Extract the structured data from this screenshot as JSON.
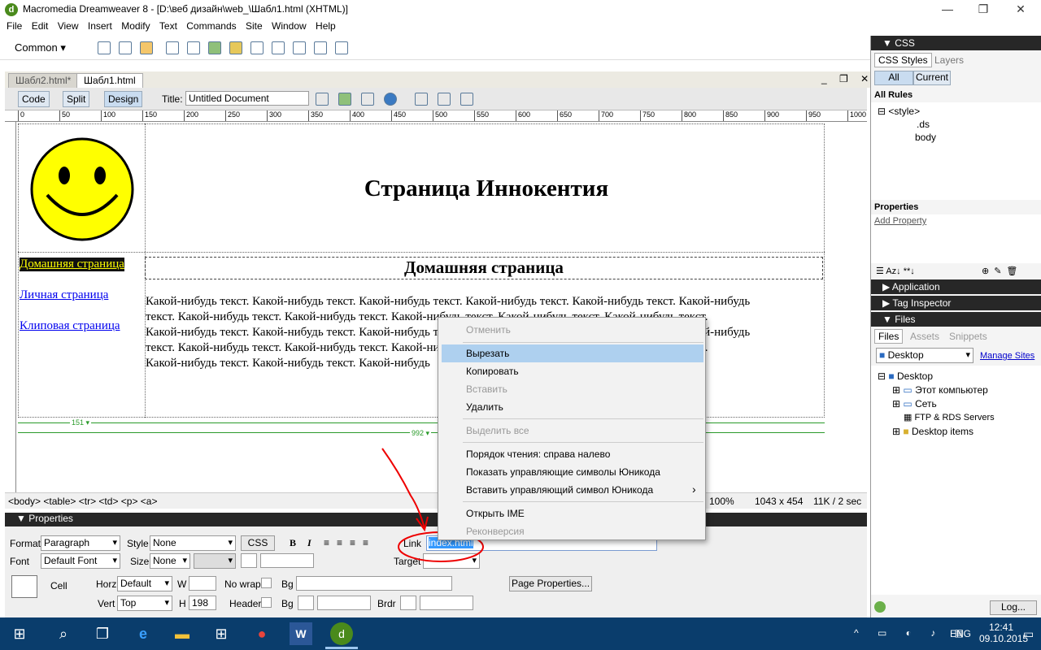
{
  "window": {
    "title": "Macromedia Dreamweaver 8 - [D:\\веб дизайн\\web_\\Шабл1.html (XHTML)]",
    "minimize": "—",
    "restore": "❐",
    "close": "✕"
  },
  "menu": [
    "File",
    "Edit",
    "View",
    "Insert",
    "Modify",
    "Text",
    "Commands",
    "Site",
    "Window",
    "Help"
  ],
  "insertbar": {
    "category": "Common"
  },
  "doc": {
    "tabs": [
      "Шабл2.html*",
      "Шабл1.html"
    ],
    "active_tab": 1,
    "view_buttons": [
      "Code",
      "Split",
      "Design"
    ],
    "title_label": "Title:",
    "title_value": "Untitled Document"
  },
  "ruler": {
    "h_ticks": [
      "0",
      "50",
      "100",
      "150",
      "200",
      "250",
      "300",
      "350",
      "400",
      "450",
      "500",
      "550",
      "600",
      "650",
      "700",
      "750",
      "800",
      "850",
      "900",
      "950",
      "1000"
    ]
  },
  "page": {
    "heading": "Страница Иннокентия",
    "nav": [
      "Домашняя страница",
      "Личная страница",
      "Клиповая страница"
    ],
    "subheading": "Домашняя страница",
    "body_lines": [
      "Какой-нибудь текст. Какой-нибудь текст. Какой-нибудь текст. Какой-нибудь текст. Какой-нибудь текст. Какой-нибудь",
      "текст. Какой-нибудь текст. Какой-нибудь текст. Какой-нибудь текст. Какой-нибудь текст. Какой-нибудь текст.",
      "Какой-нибудь текст. Какой-нибудь текст. Какой-нибудь текст. Какой-нибудь текст. Какой-нибудь текст. Какой-нибудь",
      "текст. Какой-нибудь текст. Какой-нибудь текст. Какой-нибудь текст. Какой-нибудь текст. Какой-нибудь текст.",
      "Какой-нибудь текст. Какой-нибудь текст. Какой-нибудь"
    ],
    "width1": "151 ▾",
    "width2": "992 ▾"
  },
  "statusbar": {
    "tags": "<body> <table> <tr> <td> <p> <a>",
    "zoom": "100%",
    "size": "1043 x 454",
    "weight": "11K / 2 sec"
  },
  "properties": {
    "header": "Properties",
    "format_label": "Format",
    "format": "Paragraph",
    "style_label": "Style",
    "style": "None",
    "css": "CSS",
    "font_label": "Font",
    "font": "Default Font",
    "size_label": "Size",
    "size": "None",
    "link_label": "Link",
    "link": "index.html",
    "target_label": "Target",
    "cell": "Cell",
    "horz_label": "Horz",
    "horz": "Default",
    "w_label": "W",
    "nowrap": "No wrap",
    "bg": "Bg",
    "page_props": "Page Properties...",
    "vert_label": "Vert",
    "vert": "Top",
    "h_label": "H",
    "h": "198",
    "header_label": "Header",
    "brdr": "Brdr"
  },
  "context_menu": {
    "items": [
      "Отменить",
      "Вырезать",
      "Копировать",
      "Вставить",
      "Удалить",
      "Выделить все",
      "Порядок чтения: справа налево",
      "Показать управляющие символы Юникода",
      "Вставить управляющий символ Юникода",
      "Открыть IME",
      "Реконверсия"
    ],
    "submenu_arrow": "›"
  },
  "panels": {
    "css_header": "CSS",
    "tabs": [
      "CSS Styles",
      "Layers"
    ],
    "toggle": [
      "All",
      "Current"
    ],
    "all_rules": "All Rules",
    "rules": [
      "<style>",
      ".ds",
      "body"
    ],
    "properties": "Properties",
    "add_property": "Add Property",
    "application": "Application",
    "tag_inspector": "Tag Inspector",
    "files_header": "Files",
    "files_tabs": [
      "Files",
      "Assets",
      "Snippets"
    ],
    "site": "Desktop",
    "manage_sites": "Manage Sites",
    "tree": [
      "Desktop",
      "Этот компьютер",
      "Сеть",
      "FTP & RDS Servers",
      "Desktop items"
    ],
    "log": "Log..."
  },
  "taskbar": {
    "time": "12:41",
    "date": "09.10.2015",
    "lang": "ENG"
  }
}
